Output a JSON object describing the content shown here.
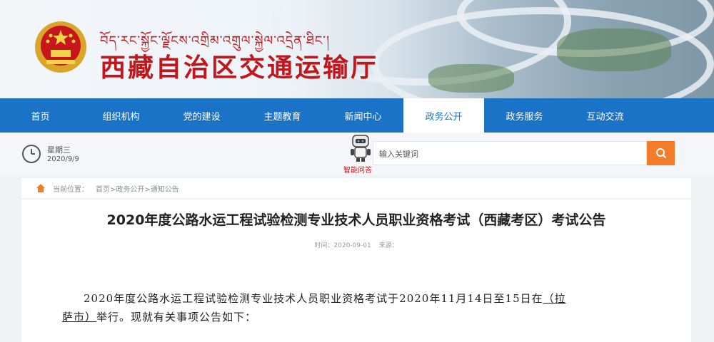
{
  "header": {
    "tibetan_title": "བོད་རང་སྐྱོང་ལྗོངས་འགྲིམ་འགྲུལ་སྐྱེལ་འདྲེན་ཐིང་།",
    "chinese_title": "西藏自治区交通运输厅"
  },
  "nav": {
    "items": [
      {
        "label": "首页"
      },
      {
        "label": "组织机构"
      },
      {
        "label": "党的建设"
      },
      {
        "label": "主题教育"
      },
      {
        "label": "新闻中心"
      },
      {
        "label": "政务公开"
      },
      {
        "label": "政务服务"
      },
      {
        "label": "互动交流"
      }
    ],
    "active_index": 5
  },
  "info": {
    "weekday": "星期三",
    "date": "2020/9/9",
    "assistant_label": "智能问答",
    "search_placeholder": "输入关键词"
  },
  "breadcrumb": {
    "prefix": "当前位置：",
    "path": "首页>政务公开>通知公告"
  },
  "article": {
    "title": "2020年度公路水运工程试验检测专业技术人员职业资格考试（西藏考区）考试公告",
    "time_label": "时间：2020-09-01",
    "source_label": "来源：",
    "body_line1_a": "2020年度公路水运工程试验检测专业技术人员职业资格考试于2020年11月14日至15日在",
    "body_line1_b": "（拉",
    "body_line2_a": "萨市）",
    "body_line2_b": "举行。现就有关事项公告如下："
  },
  "colors": {
    "brand_red": "#c0171c",
    "nav_blue": "#1a73c6",
    "search_orange": "#f27c2a"
  }
}
